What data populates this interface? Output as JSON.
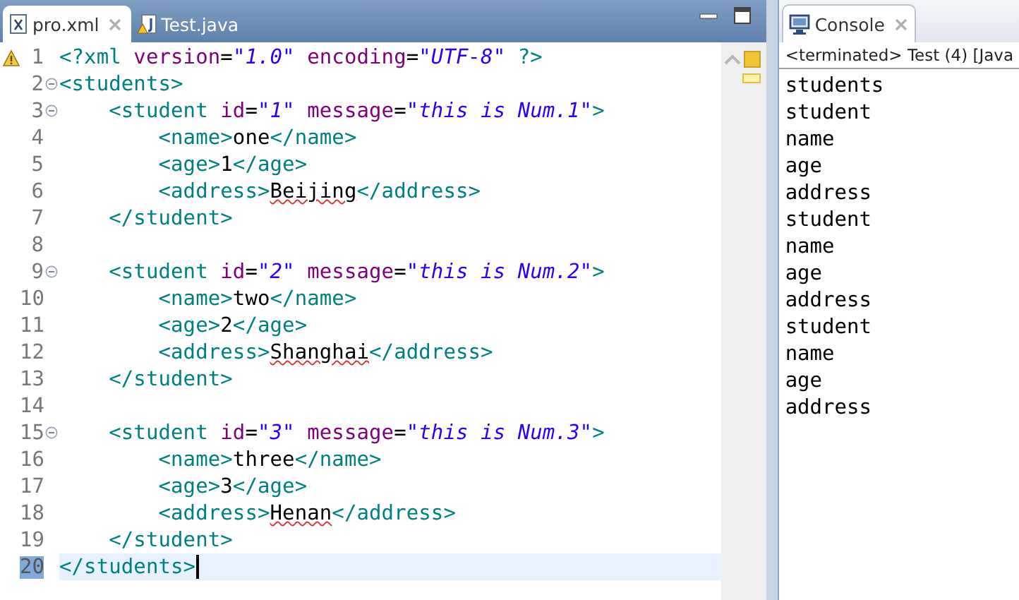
{
  "editor": {
    "tabs": [
      {
        "label": "pro.xml",
        "selected": true,
        "closable": true
      },
      {
        "label": "Test.java",
        "selected": false,
        "closable": false
      }
    ],
    "lines": [
      {
        "number": "1",
        "warning": true,
        "fold": false,
        "current": false,
        "tokens": [
          {
            "kind": "tag",
            "text": "<?xml"
          },
          {
            "kind": "attr",
            "text": " version"
          },
          {
            "kind": "plain",
            "text": "="
          },
          {
            "kind": "value",
            "text": "\"1.0\""
          },
          {
            "kind": "attr",
            "text": " encoding"
          },
          {
            "kind": "plain",
            "text": "="
          },
          {
            "kind": "value",
            "text": "\"UTF-8\""
          },
          {
            "kind": "tag",
            "text": " ?>"
          }
        ]
      },
      {
        "number": "2",
        "warning": false,
        "fold": true,
        "current": false,
        "tokens": [
          {
            "kind": "tag",
            "text": "<students>"
          }
        ]
      },
      {
        "number": "3",
        "warning": false,
        "fold": true,
        "current": false,
        "tokens": [
          {
            "kind": "tag",
            "text": "    <student"
          },
          {
            "kind": "attr",
            "text": " id"
          },
          {
            "kind": "plain",
            "text": "="
          },
          {
            "kind": "value",
            "text": "\"1\""
          },
          {
            "kind": "attr",
            "text": " message"
          },
          {
            "kind": "plain",
            "text": "="
          },
          {
            "kind": "value",
            "text": "\"this is Num.1\""
          },
          {
            "kind": "tag",
            "text": ">"
          }
        ]
      },
      {
        "number": "4",
        "warning": false,
        "fold": false,
        "current": false,
        "tokens": [
          {
            "kind": "tag",
            "text": "        <name>"
          },
          {
            "kind": "plain",
            "text": "one"
          },
          {
            "kind": "tag",
            "text": "</name>"
          }
        ]
      },
      {
        "number": "5",
        "warning": false,
        "fold": false,
        "current": false,
        "tokens": [
          {
            "kind": "tag",
            "text": "        <age>"
          },
          {
            "kind": "plain",
            "text": "1"
          },
          {
            "kind": "tag",
            "text": "</age>"
          }
        ]
      },
      {
        "number": "6",
        "warning": false,
        "fold": false,
        "current": false,
        "tokens": [
          {
            "kind": "tag",
            "text": "        <address>"
          },
          {
            "kind": "flagged",
            "text": "Beijing"
          },
          {
            "kind": "tag",
            "text": "</address>"
          }
        ]
      },
      {
        "number": "7",
        "warning": false,
        "fold": false,
        "current": false,
        "tokens": [
          {
            "kind": "tag",
            "text": "    </student>"
          }
        ]
      },
      {
        "number": "8",
        "warning": false,
        "fold": false,
        "current": false
      },
      {
        "number": "9",
        "warning": false,
        "fold": true,
        "current": false,
        "tokens": [
          {
            "kind": "tag",
            "text": "    <student"
          },
          {
            "kind": "attr",
            "text": " id"
          },
          {
            "kind": "plain",
            "text": "="
          },
          {
            "kind": "value",
            "text": "\"2\""
          },
          {
            "kind": "attr",
            "text": " message"
          },
          {
            "kind": "plain",
            "text": "="
          },
          {
            "kind": "value",
            "text": "\"this is Num.2\""
          },
          {
            "kind": "tag",
            "text": ">"
          }
        ]
      },
      {
        "number": "10",
        "warning": false,
        "fold": false,
        "current": false,
        "tokens": [
          {
            "kind": "tag",
            "text": "        <name>"
          },
          {
            "kind": "plain",
            "text": "two"
          },
          {
            "kind": "tag",
            "text": "</name>"
          }
        ]
      },
      {
        "number": "11",
        "warning": false,
        "fold": false,
        "current": false,
        "tokens": [
          {
            "kind": "tag",
            "text": "        <age>"
          },
          {
            "kind": "plain",
            "text": "2"
          },
          {
            "kind": "tag",
            "text": "</age>"
          }
        ]
      },
      {
        "number": "12",
        "warning": false,
        "fold": false,
        "current": false,
        "tokens": [
          {
            "kind": "tag",
            "text": "        <address>"
          },
          {
            "kind": "flagged",
            "text": "Shanghai"
          },
          {
            "kind": "tag",
            "text": "</address>"
          }
        ]
      },
      {
        "number": "13",
        "warning": false,
        "fold": false,
        "current": false,
        "tokens": [
          {
            "kind": "tag",
            "text": "    </student>"
          }
        ]
      },
      {
        "number": "14",
        "warning": false,
        "fold": false,
        "current": false
      },
      {
        "number": "15",
        "warning": false,
        "fold": true,
        "current": false,
        "tokens": [
          {
            "kind": "tag",
            "text": "    <student"
          },
          {
            "kind": "attr",
            "text": " id"
          },
          {
            "kind": "plain",
            "text": "="
          },
          {
            "kind": "value",
            "text": "\"3\""
          },
          {
            "kind": "attr",
            "text": " message"
          },
          {
            "kind": "plain",
            "text": "="
          },
          {
            "kind": "value",
            "text": "\"this is Num.3\""
          },
          {
            "kind": "tag",
            "text": ">"
          }
        ]
      },
      {
        "number": "16",
        "warning": false,
        "fold": false,
        "current": false,
        "tokens": [
          {
            "kind": "tag",
            "text": "        <name>"
          },
          {
            "kind": "plain",
            "text": "three"
          },
          {
            "kind": "tag",
            "text": "</name>"
          }
        ]
      },
      {
        "number": "17",
        "warning": false,
        "fold": false,
        "current": false,
        "tokens": [
          {
            "kind": "tag",
            "text": "        <age>"
          },
          {
            "kind": "plain",
            "text": "3"
          },
          {
            "kind": "tag",
            "text": "</age>"
          }
        ]
      },
      {
        "number": "18",
        "warning": false,
        "fold": false,
        "current": false,
        "tokens": [
          {
            "kind": "tag",
            "text": "        <address>"
          },
          {
            "kind": "flagged",
            "text": "Henan"
          },
          {
            "kind": "tag",
            "text": "</address>"
          }
        ]
      },
      {
        "number": "19",
        "warning": false,
        "fold": false,
        "current": false,
        "tokens": [
          {
            "kind": "tag",
            "text": "    </student>"
          }
        ]
      },
      {
        "number": "20",
        "warning": false,
        "fold": false,
        "current": true,
        "tokens": [
          {
            "kind": "tag",
            "text": "</students>"
          }
        ]
      }
    ]
  },
  "console": {
    "tab": {
      "label": "Console",
      "selected": true
    },
    "header": "<terminated> Test (4) [Java",
    "output": [
      "students",
      "student",
      "name",
      "age",
      "address",
      "student",
      "name",
      "age",
      "address",
      "student",
      "name",
      "age",
      "address"
    ]
  }
}
